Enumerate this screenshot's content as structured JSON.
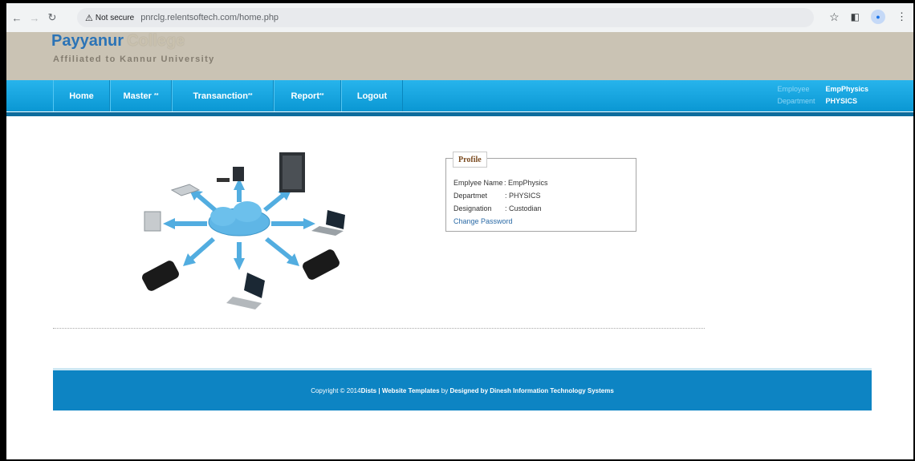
{
  "browser": {
    "security_label": "Not secure",
    "url": "pnrclg.relentsoftech.com/home.php"
  },
  "header": {
    "brand_primary": "Payyanur",
    "brand_secondary": "College",
    "subtitle": "Affiliated to Kannur University"
  },
  "menu": {
    "items": [
      {
        "label": "Home",
        "suffix": ""
      },
      {
        "label": "Master",
        "suffix": "**"
      },
      {
        "label": "Transanction",
        "suffix": "**"
      },
      {
        "label": "Report",
        "suffix": "**"
      },
      {
        "label": "Logout",
        "suffix": ""
      }
    ]
  },
  "user": {
    "employee_label": "Employee",
    "employee_value": "EmpPhysics",
    "department_label": "Department",
    "department_value": "PHYSICS"
  },
  "profile": {
    "legend": "Profile",
    "rows": [
      {
        "label": "Emplyee Name",
        "value": ": EmpPhysics"
      },
      {
        "label": "Departmet",
        "value": ": PHYSICS"
      },
      {
        "label": "Designation",
        "value": ": Custodian"
      }
    ],
    "change_password": "Change Password"
  },
  "footer": {
    "copyright": "Copyright © 2014 ",
    "brand": "Dists",
    "sep": " | ",
    "templates": "Website Templates",
    "by": " by ",
    "designer": "Designed by Dinesh Information Technology Systems"
  },
  "colors": {
    "menu_bar": "#0a97d3",
    "header_bg": "#cac3b4",
    "footer_bg": "#0d84c3",
    "brand_blue": "#2b73b6"
  },
  "icons": [
    "back-icon",
    "forward-icon",
    "reload-icon",
    "warning-icon",
    "star-icon",
    "sidepanel-icon",
    "profile-icon",
    "kebab-icon"
  ]
}
